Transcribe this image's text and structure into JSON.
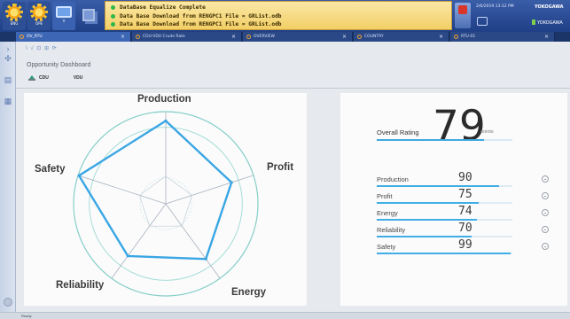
{
  "header": {
    "buttons": [
      {
        "label": "ENG",
        "icon": "sun-icon"
      },
      {
        "label": "OPE",
        "icon": "sun-icon"
      },
      {
        "label": "V",
        "icon": "screen-icon"
      },
      {
        "label": "",
        "icon": "copy-icon"
      }
    ],
    "messages": [
      "DataBase Equalize Complete",
      "Data Base Download from RENGPC1 File = GRList.odb",
      "Data Base Download from RENGPC1 File = GRList.odb"
    ],
    "clock": "2/6/2019 13:12 PM",
    "brand": "YOKOGAWA",
    "brand_sub": "YOKOGAWA"
  },
  "tabs": [
    {
      "label": "OV_RTU",
      "active": true
    },
    {
      "label": "CDU-VDU Crude  Rate",
      "active": false
    },
    {
      "label": "OVERVIEW",
      "active": false
    },
    {
      "label": "COUNTRY",
      "active": false
    },
    {
      "label": "RTU-01",
      "active": false
    }
  ],
  "toolbar": {
    "icons": "\\ √ ⊡ ⊞ ⟳"
  },
  "dashboard": {
    "title": "Opportunity Dashboard",
    "tree": [
      "CDU",
      "VDU"
    ]
  },
  "overall": {
    "label": "Overall Rating",
    "value": "79",
    "unit": "points",
    "fraction": 0.79
  },
  "metrics": [
    {
      "label": "Production",
      "value": "90",
      "fraction": 0.9
    },
    {
      "label": "Profit",
      "value": "75",
      "fraction": 0.75
    },
    {
      "label": "Energy",
      "value": "74",
      "fraction": 0.74
    },
    {
      "label": "Reliability",
      "value": "70",
      "fraction": 0.7
    },
    {
      "label": "Safety",
      "value": "99",
      "fraction": 0.99
    }
  ],
  "radar": {
    "axes": [
      "Production",
      "Profit",
      "Energy",
      "Reliability",
      "Safety"
    ],
    "max": 100
  },
  "statusbar": {
    "text": "Ready"
  },
  "colors": {
    "accent": "#3fa8e0",
    "header": "#2a4b96",
    "alarm_box": "#f4d36e"
  }
}
